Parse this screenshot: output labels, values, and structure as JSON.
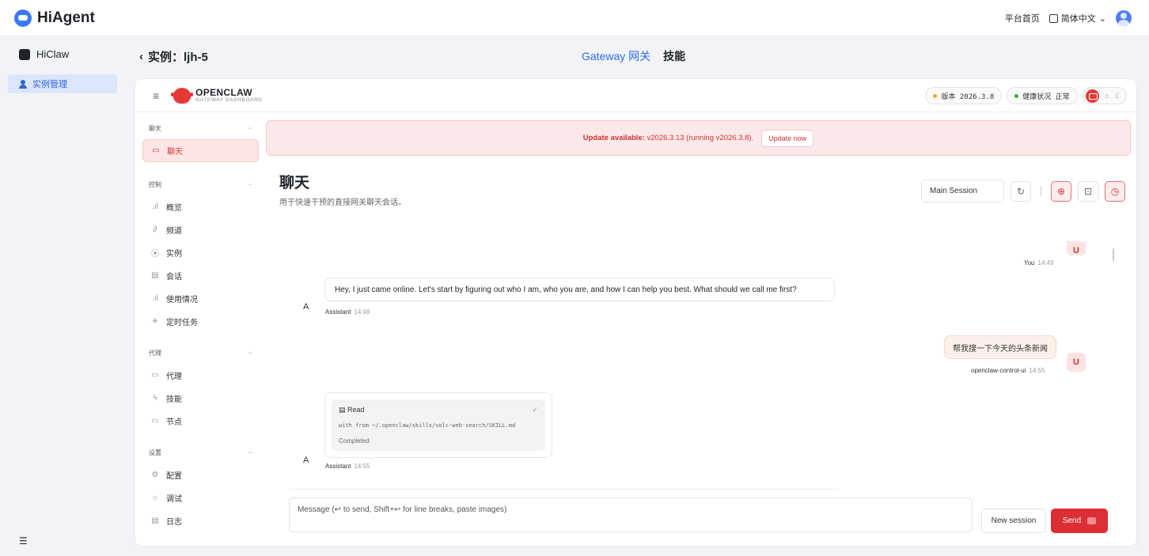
{
  "app": {
    "name": "HiAgent"
  },
  "topbar": {
    "home_link": "平台首页",
    "language": "简体中文"
  },
  "sidebar": {
    "app_name": "HiClaw",
    "items": [
      {
        "label": "实例管理"
      }
    ]
  },
  "subheader": {
    "back_label": "实例：ljh-5",
    "tabs": [
      {
        "label": "Gateway 网关",
        "active": true
      },
      {
        "label": "技能",
        "active": false
      }
    ]
  },
  "openclaw": {
    "title": "OPENCLAW",
    "subtitle": "GATEWAY DASHBOARD",
    "version_pill": "版本 2026.3.8",
    "health_pill": "健康状况 正常",
    "colors": {
      "accent": "#dc2f35",
      "version_dot": "#f5a623",
      "health_dot": "#2fb344"
    }
  },
  "nav": {
    "groups": [
      {
        "label": "聊天",
        "items": [
          {
            "label": "聊天",
            "icon": "chat-icon",
            "active": true
          }
        ]
      },
      {
        "label": "控制",
        "items": [
          {
            "label": "概览",
            "icon": "bar-chart-icon"
          },
          {
            "label": "频道",
            "icon": "link-icon"
          },
          {
            "label": "实例",
            "icon": "radio-icon"
          },
          {
            "label": "会话",
            "icon": "document-icon"
          },
          {
            "label": "使用情况",
            "icon": "bar-chart-icon"
          },
          {
            "label": "定时任务",
            "icon": "loader-icon"
          }
        ]
      },
      {
        "label": "代理",
        "items": [
          {
            "label": "代理",
            "icon": "folder-icon"
          },
          {
            "label": "技能",
            "icon": "zap-icon"
          },
          {
            "label": "节点",
            "icon": "monitor-icon"
          }
        ]
      },
      {
        "label": "设置",
        "items": [
          {
            "label": "配置",
            "icon": "gear-icon"
          },
          {
            "label": "调试",
            "icon": "bug-icon"
          },
          {
            "label": "日志",
            "icon": "log-icon"
          }
        ]
      }
    ]
  },
  "banner": {
    "bold": "Update available:",
    "text": "v2026.3.13 (running v2026.3.8).",
    "button": "Update now"
  },
  "page": {
    "title": "聊天",
    "subtitle": "用于快速干预的直接网关聊天会话。",
    "session": "Main Session"
  },
  "messages": {
    "m1": {
      "sender": "You",
      "time": "14:49",
      "avatar": "U"
    },
    "m2": {
      "avatar": "A",
      "text": "Hey, I just came online. Let's start by figuring out who I am, who you are, and how I can help you best. What should we call me first?",
      "sender": "Assistant",
      "time": "14:49"
    },
    "m3": {
      "text": "帮我搜一下今天的头条新闻",
      "sender": "openclaw-control-ui",
      "time": "14:55",
      "avatar": "U"
    },
    "m4": {
      "avatar": "A",
      "tool": "Read",
      "cmd": "with from ~/.openclaw/skills/volc-web-search/SKILL.md",
      "status": "Completed",
      "sender": "Assistant",
      "time": "14:55"
    }
  },
  "composer": {
    "placeholder": "Message (↩ to send, Shift+↩ for line breaks, paste images)",
    "new_session": "New session",
    "send": "Send"
  }
}
